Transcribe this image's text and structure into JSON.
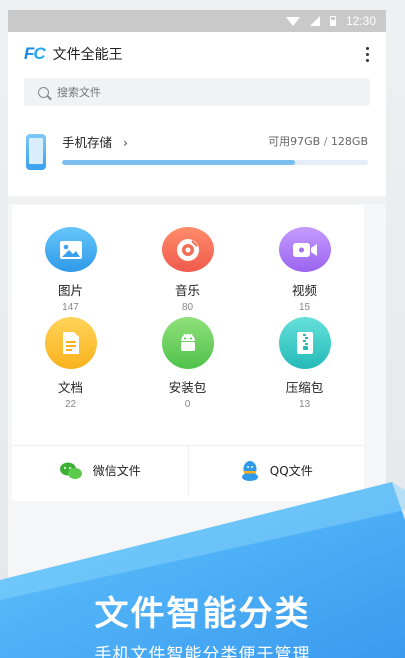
{
  "status_bar": {
    "time": "12:30"
  },
  "app": {
    "logo": "FC",
    "title": "文件全能王"
  },
  "search": {
    "placeholder": "搜索文件"
  },
  "storage": {
    "title": "手机存储",
    "available": "可用97GB",
    "separator": "/",
    "total": "128GB",
    "used_fraction": 0.76
  },
  "categories": [
    {
      "label": "图片",
      "count": "147",
      "icon": "image-icon"
    },
    {
      "label": "音乐",
      "count": "80",
      "icon": "music-disc-icon"
    },
    {
      "label": "视频",
      "count": "15",
      "icon": "video-camera-icon"
    },
    {
      "label": "文档",
      "count": "22",
      "icon": "document-icon"
    },
    {
      "label": "安装包",
      "count": "0",
      "icon": "android-icon"
    },
    {
      "label": "压缩包",
      "count": "13",
      "icon": "zip-icon"
    }
  ],
  "shortcuts": [
    {
      "label": "微信文件",
      "icon": "wechat-icon"
    },
    {
      "label": "QQ文件",
      "icon": "qq-icon"
    }
  ],
  "banner": {
    "title": "文件智能分类",
    "subtitle": "手机文件智能分类便于管理"
  },
  "colors": {
    "accent": "#1e88e5",
    "banner_blue": "#4aaef5"
  }
}
